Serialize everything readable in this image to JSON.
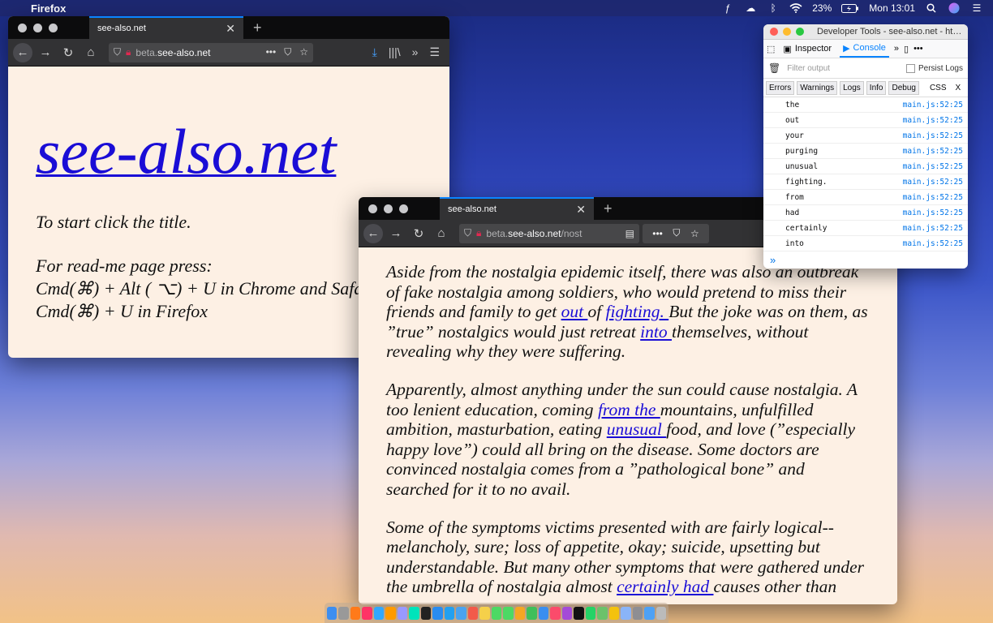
{
  "menubar": {
    "app_name": "Firefox",
    "battery": "23%",
    "clock": "Mon 13:01"
  },
  "window1": {
    "tab_title": "see-also.net",
    "url_prefix": "beta.",
    "url_domain": "see-also.net",
    "site_title": "see-also.net",
    "line1": "To start click the title.",
    "line2": "For read-me page press:",
    "line3": "Cmd(⌘) + Alt ( ⌥) + U in Chrome and Safari",
    "line4": "Cmd(⌘) + U in Firefox"
  },
  "window2": {
    "tab_title": "see-also.net",
    "url_prefix": "beta.",
    "url_domain": "see-also.net",
    "url_path": "/nost",
    "p1": {
      "a": "Aside from the nostalgia epidemic itself, there was also an outbreak of fake nostalgia among soldiers, who would pretend to miss their friends and family to get ",
      "link1": "out ",
      "b": "of ",
      "link2": "fighting. ",
      "c": "But the joke was on them, as ”true” nostalgics would just retreat ",
      "link3": "into ",
      "d": "themselves, without revealing why they were suffering."
    },
    "p2": {
      "a": "Apparently, almost anything under the sun could cause nostalgia. A too lenient education, coming ",
      "link1": "from the ",
      "b": "mountains, unfulfilled ambition, masturbation, eating ",
      "link2": "unusual ",
      "c": "food, and love (”especially happy love”) could all bring on the disease. Some doctors are convinced nostalgia comes from a ”pathological bone” and searched for it to no avail."
    },
    "p3": {
      "a": "Some of the symptoms victims presented with are fairly logical--melancholy, sure; loss of appetite, okay; suicide, upsetting but understandable. But many other symptoms that were gathered under the umbrella of nostalgia almost ",
      "link1": "certainly had ",
      "b": "causes other than"
    }
  },
  "devtools": {
    "title": "Developer Tools - see-also.net - ht…",
    "tab_inspector": "Inspector",
    "tab_console": "Console",
    "filter_placeholder": "Filter output",
    "persist_logs": "Persist Logs",
    "levels": [
      "Errors",
      "Warnings",
      "Logs",
      "Info",
      "Debug"
    ],
    "css": "CSS",
    "x": "X",
    "rows": [
      {
        "msg": "the",
        "src": "main.js:52:25"
      },
      {
        "msg": "out",
        "src": "main.js:52:25"
      },
      {
        "msg": "your",
        "src": "main.js:52:25"
      },
      {
        "msg": "purging",
        "src": "main.js:52:25"
      },
      {
        "msg": "unusual",
        "src": "main.js:52:25"
      },
      {
        "msg": "fighting.",
        "src": "main.js:52:25"
      },
      {
        "msg": "from",
        "src": "main.js:52:25"
      },
      {
        "msg": "had",
        "src": "main.js:52:25"
      },
      {
        "msg": "certainly",
        "src": "main.js:52:25"
      },
      {
        "msg": "into",
        "src": "main.js:52:25"
      }
    ],
    "prompt": "»"
  },
  "dock": {
    "icons": [
      "finder-icon",
      "launchpad-icon",
      "firefox-icon",
      "indesign-icon",
      "photoshop-icon",
      "illustrator-icon",
      "premiere-icon",
      "audition-icon",
      "terminal-icon",
      "safari-icon",
      "vscode-icon",
      "mail-icon",
      "calendar-icon",
      "notes-icon",
      "messages-icon",
      "facetime-icon",
      "pages-icon",
      "numbers-icon",
      "keynote-icon",
      "music-icon",
      "podcasts-icon",
      "tv-icon",
      "whatsapp-icon",
      "maps-icon",
      "chrome-icon",
      "preview-icon",
      "settings-icon",
      "folder-icon",
      "trash-icon"
    ],
    "colors": [
      "#3d8ef0",
      "#999",
      "#ff7a1a",
      "#ff3366",
      "#31a8ff",
      "#ff9a00",
      "#9999ff",
      "#00e4bb",
      "#222",
      "#2a8cf0",
      "#23a0f0",
      "#4aa3f0",
      "#f25a4a",
      "#f5d04a",
      "#4cd964",
      "#4cd964",
      "#f5a623",
      "#3fbf5a",
      "#3a8ef0",
      "#fb4b6b",
      "#a44bd8",
      "#111",
      "#25d366",
      "#6bc26b",
      "#f4c20d",
      "#8ab4f8",
      "#8e8e93",
      "#4ea1f5",
      "#bbb"
    ]
  }
}
